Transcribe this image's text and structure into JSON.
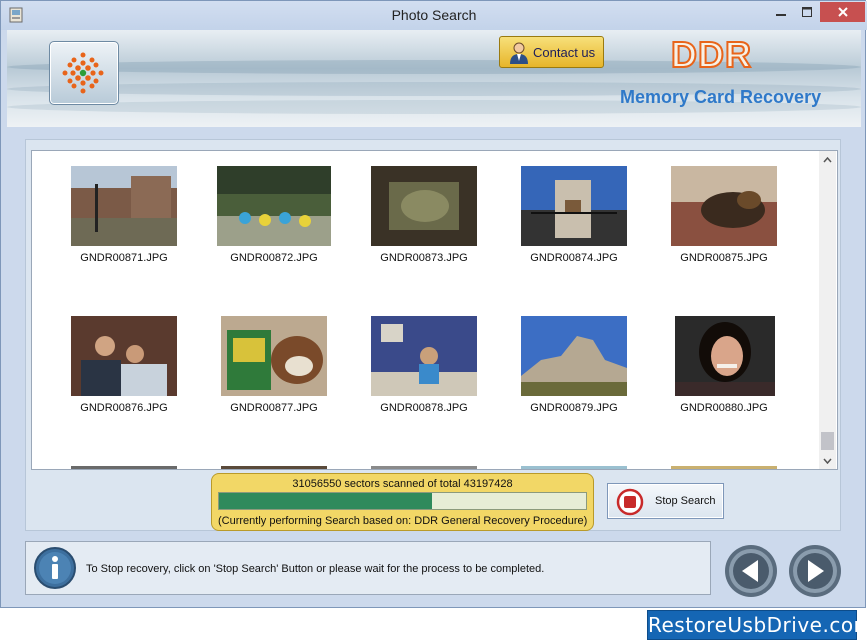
{
  "window": {
    "title": "Photo Search"
  },
  "header": {
    "contact_label": "Contact us",
    "brand": "DDR",
    "subtitle": "Memory Card Recovery"
  },
  "files": [
    "GNDR00871.JPG",
    "GNDR00872.JPG",
    "GNDR00873.JPG",
    "GNDR00874.JPG",
    "GNDR00875.JPG",
    "GNDR00876.JPG",
    "GNDR00877.JPG",
    "GNDR00878.JPG",
    "GNDR00879.JPG",
    "GNDR00880.JPG"
  ],
  "progress": {
    "status": "31056550 sectors scanned of total 43197428",
    "fraction": 0.58,
    "note": "(Currently performing Search based on:  DDR General Recovery Procedure)"
  },
  "stop_label": "Stop Search",
  "status_text": "To Stop recovery, click on 'Stop Search' Button or please wait for the process to be completed.",
  "watermark": "RestoreUsbDrive.com",
  "icons": {
    "app": "app-icon",
    "minimize": "minimize-icon",
    "maximize": "maximize-icon",
    "close": "close-icon",
    "logo": "ddr-logo-icon",
    "contact": "user-icon",
    "stop": "stop-icon",
    "info": "info-icon",
    "back": "back-arrow-icon",
    "next": "next-arrow-icon"
  },
  "colors": {
    "accent": "#e8641a",
    "subtitle": "#2f79c9",
    "progress_fill": "#2f8a5c",
    "progress_box": "#f2d766"
  }
}
